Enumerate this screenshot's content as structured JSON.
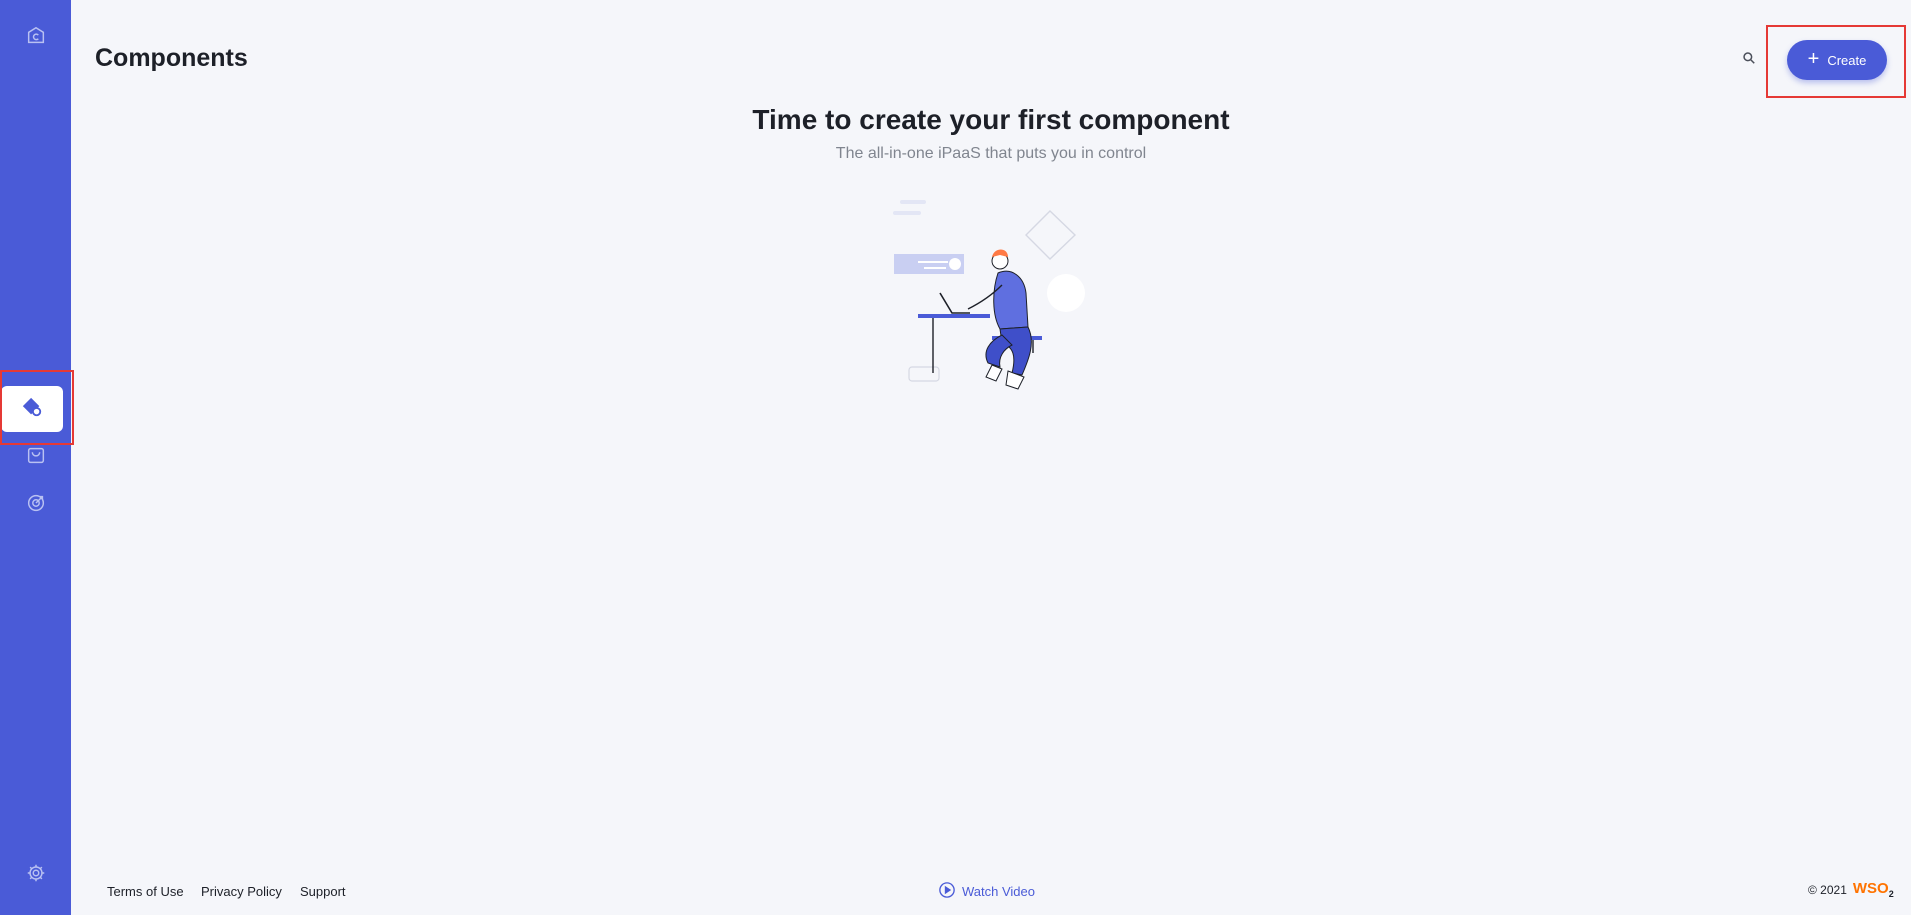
{
  "page": {
    "title": "Components"
  },
  "header": {
    "create_label": "Create"
  },
  "empty_state": {
    "title": "Time to create your first component",
    "subtitle": "The all-in-one iPaaS that puts you in control"
  },
  "sidebar": {
    "items": [
      {
        "icon": "home-icon"
      },
      {
        "icon": "components-icon",
        "active": true
      },
      {
        "icon": "marketplace-icon"
      },
      {
        "icon": "observability-icon"
      },
      {
        "icon": "gear-icon"
      }
    ]
  },
  "footer": {
    "terms": "Terms of Use",
    "privacy": "Privacy Policy",
    "support": "Support",
    "watch_video": "Watch Video",
    "copyright": "© 2021",
    "logo": "WSO",
    "logo_sub": "2"
  },
  "colors": {
    "accent": "#4a5bd7",
    "brand": "#ff7300",
    "highlight": "#e53935"
  }
}
